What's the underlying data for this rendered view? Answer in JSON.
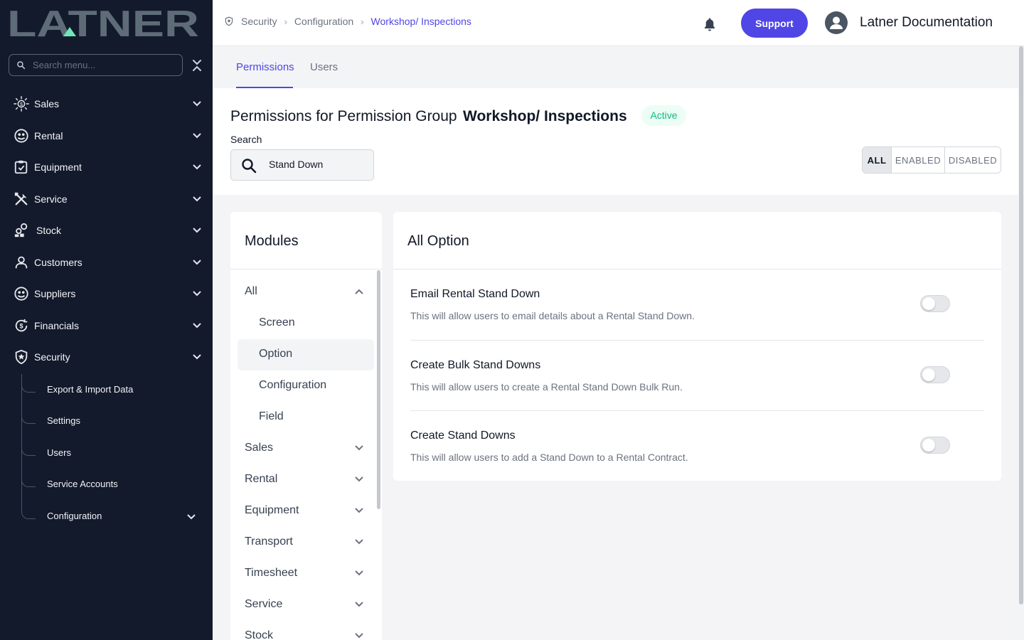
{
  "brand": {
    "logo_text": "LATNER"
  },
  "sidebar": {
    "search_placeholder": "Search menu...",
    "items": [
      {
        "label": "Sales",
        "icon": "sales-icon"
      },
      {
        "label": "Rental",
        "icon": "rental-icon"
      },
      {
        "label": "Equipment",
        "icon": "equipment-icon"
      },
      {
        "label": "Service",
        "icon": "service-icon"
      },
      {
        "label": "Stock",
        "icon": "stock-icon"
      },
      {
        "label": "Customers",
        "icon": "customers-icon"
      },
      {
        "label": "Suppliers",
        "icon": "suppliers-icon"
      },
      {
        "label": "Financials",
        "icon": "financials-icon"
      },
      {
        "label": "Security",
        "icon": "security-icon"
      }
    ],
    "security_subitems": [
      {
        "label": "Export & Import Data"
      },
      {
        "label": "Settings"
      },
      {
        "label": "Users"
      },
      {
        "label": "Service Accounts"
      },
      {
        "label": "Configuration"
      }
    ]
  },
  "header": {
    "breadcrumb": [
      "Security",
      "Configuration",
      "Workshop/ Inspections"
    ],
    "support_label": "Support",
    "user_name": "Latner Documentation"
  },
  "tabs": [
    {
      "label": "Permissions",
      "active": true
    },
    {
      "label": "Users",
      "active": false
    }
  ],
  "permissions": {
    "title_prefix": "Permissions for Permission Group",
    "group_name": "Workshop/ Inspections",
    "status": "Active",
    "search_label": "Search",
    "search_value": "Stand Down",
    "filters": [
      {
        "label": "ALL",
        "active": true
      },
      {
        "label": "ENABLED",
        "active": false
      },
      {
        "label": "DISABLED",
        "active": false
      }
    ]
  },
  "modules": {
    "title": "Modules",
    "items": [
      {
        "label": "All",
        "expanded": true
      },
      {
        "label": "Screen",
        "sub": true
      },
      {
        "label": "Option",
        "sub": true,
        "selected": true
      },
      {
        "label": "Configuration",
        "sub": true
      },
      {
        "label": "Field",
        "sub": true
      },
      {
        "label": "Sales"
      },
      {
        "label": "Rental"
      },
      {
        "label": "Equipment"
      },
      {
        "label": "Transport"
      },
      {
        "label": "Timesheet"
      },
      {
        "label": "Service"
      },
      {
        "label": "Stock"
      }
    ]
  },
  "options": {
    "title": "All Option",
    "rows": [
      {
        "title": "Email Rental Stand Down",
        "description": "This will allow users to email details about a Rental Stand Down.",
        "enabled": false
      },
      {
        "title": "Create Bulk Stand Downs",
        "description": "This will allow users to create a Rental Stand Down Bulk Run.",
        "enabled": false
      },
      {
        "title": "Create Stand Downs",
        "description": "This will allow users to add a Stand Down to a Rental Contract.",
        "enabled": false
      }
    ]
  },
  "colors": {
    "accent": "#4f46e5",
    "sidebar_bg": "#131a2c",
    "logo": "#5e6c78",
    "logo_triangle": "#6ee7b7",
    "status_green": "#10b981"
  }
}
